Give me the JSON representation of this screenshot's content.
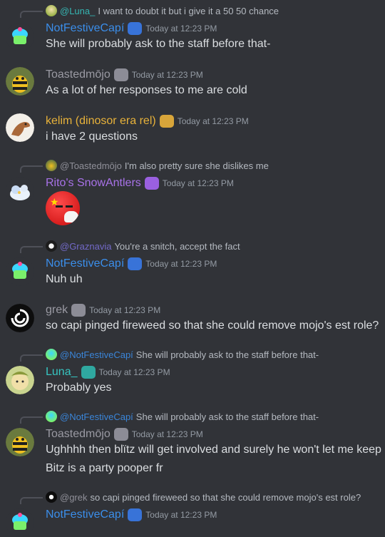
{
  "colors": {
    "background": "#313338",
    "notfestive": "#3b8eea",
    "toasted": "#9a9aa3",
    "kelim": "#e8b23a",
    "rito": "#a872e8",
    "grek": "#9a9aa3",
    "luna": "#36c4c0"
  },
  "messages": [
    {
      "reply": {
        "name": "@Luna_",
        "text": "I want to doubt it but i give it a 50 50 chance",
        "avatar_icon": "luna-avatar-icon"
      },
      "username": "NotFestiveCapí",
      "time": "Today at 12:23 PM",
      "lines": [
        "She will probably ask to the staff before that-"
      ],
      "avatar_icon": "cupcake-avatar-icon",
      "badge_icon": "blue-badge-icon"
    },
    {
      "username": "Toastedmōjo",
      "time": "Today at 12:23 PM",
      "lines": [
        "As a lot of her responses to me are cold"
      ],
      "avatar_icon": "bee-avatar-icon",
      "badge_icon": "grey-badge-icon"
    },
    {
      "username": "kelim (dinosor era rel)",
      "time": "Today at 12:23 PM",
      "lines": [
        "i have 2 questions"
      ],
      "avatar_icon": "dinosaur-avatar-icon",
      "badge_icon": "gold-badge-icon"
    },
    {
      "reply": {
        "name": "@Toastedmōjo",
        "text": "I'm also pretty sure she dislikes me",
        "avatar_icon": "bee-avatar-icon"
      },
      "username": "Rito's SnowAntlers",
      "time": "Today at 12:23 PM",
      "lines": [],
      "emoji": "china-ball-emoji",
      "avatar_icon": "snow-avatar-icon",
      "badge_icon": "purple-badge-icon"
    },
    {
      "reply": {
        "name": "@Graznavia",
        "text": "You're a snitch, accept the fact",
        "avatar_icon": "graznavia-avatar-icon"
      },
      "username": "NotFestiveCapí",
      "time": "Today at 12:23 PM",
      "lines": [
        "Nuh uh"
      ],
      "avatar_icon": "cupcake-avatar-icon",
      "badge_icon": "blue-badge-icon"
    },
    {
      "username": "grek",
      "time": "Today at 12:23 PM",
      "lines": [
        "so capi pinged fireweed so that she could remove mojo's est role?"
      ],
      "avatar_icon": "swirl-avatar-icon",
      "badge_icon": "grey-badge-icon"
    },
    {
      "reply": {
        "name": "@NotFestiveCapí",
        "text": "She will probably ask to the staff before that-",
        "avatar_icon": "cupcake-avatar-icon"
      },
      "username": "Luna_",
      "time": "Today at 12:23 PM",
      "lines": [
        "Probably yes"
      ],
      "avatar_icon": "luna-avatar-icon",
      "badge_icon": "teal-badge-icon"
    },
    {
      "reply": {
        "name": "@NotFestiveCapí",
        "text": "She will probably ask to the staff before that-",
        "avatar_icon": "cupcake-avatar-icon"
      },
      "username": "Toastedmōjo",
      "time": "Today at 12:23 PM",
      "lines": [
        "Ughhhh then blïtz will get involved and surely he won't let me keep it",
        "Bitz is a party pooper fr"
      ],
      "avatar_icon": "bee-avatar-icon",
      "badge_icon": "grey-badge-icon"
    },
    {
      "reply": {
        "name": "@grek",
        "text": "so capi pinged fireweed so that she could remove mojo's est role?",
        "avatar_icon": "swirl-avatar-icon"
      },
      "username": "NotFestiveCapí",
      "time": "Today at 12:23 PM",
      "lines": [],
      "avatar_icon": "cupcake-avatar-icon",
      "badge_icon": "blue-badge-icon"
    }
  ]
}
